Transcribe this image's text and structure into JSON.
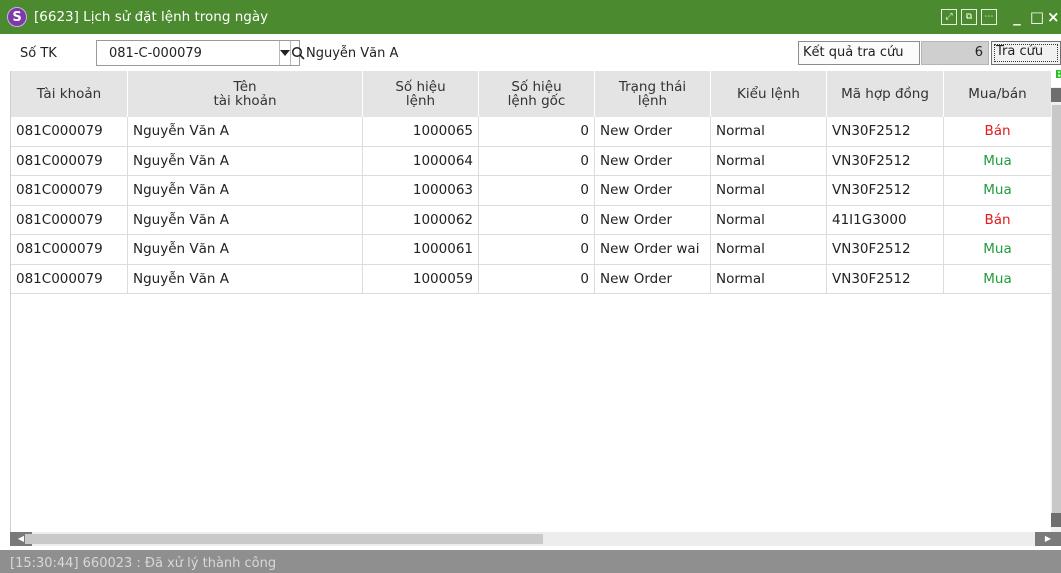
{
  "window": {
    "logo": "S",
    "title": "[6623] Lịch sử đặt lệnh trong ngày",
    "title_icons": [
      "expand-icon",
      "popout-icon",
      "more-icon"
    ],
    "controls": [
      "minimize-icon",
      "maximize-icon",
      "close-icon"
    ]
  },
  "toolbar": {
    "account_label": "Số TK",
    "account_value": "081-C-000079",
    "account_name": "Nguyễn Văn A",
    "result_label": "Kết quả tra cứu",
    "result_count": "6",
    "search_button": "Tra cứu"
  },
  "grid": {
    "columns": [
      {
        "key": "account",
        "label": "Tài khoản"
      },
      {
        "key": "name",
        "label": "Tên\ntài khoản"
      },
      {
        "key": "order_no",
        "label": "Số hiệu\nlệnh"
      },
      {
        "key": "orig_no",
        "label": "Số hiệu\nlệnh gốc"
      },
      {
        "key": "status",
        "label": "Trạng thái\nlệnh"
      },
      {
        "key": "type",
        "label": "Kiểu lệnh"
      },
      {
        "key": "contract",
        "label": "Mã hợp đồng"
      },
      {
        "key": "side",
        "label": "Mua/bán"
      }
    ],
    "rows": [
      {
        "account": "081C000079",
        "name": "Nguyễn Văn A",
        "order_no": "1000065",
        "orig_no": "0",
        "status": "New Order",
        "type": "Normal",
        "contract": "VN30F2512",
        "side": "Bán"
      },
      {
        "account": "081C000079",
        "name": "Nguyễn Văn A",
        "order_no": "1000064",
        "orig_no": "0",
        "status": "New Order",
        "type": "Normal",
        "contract": "VN30F2512",
        "side": "Mua"
      },
      {
        "account": "081C000079",
        "name": "Nguyễn Văn A",
        "order_no": "1000063",
        "orig_no": "0",
        "status": "New Order",
        "type": "Normal",
        "contract": "VN30F2512",
        "side": "Mua"
      },
      {
        "account": "081C000079",
        "name": "Nguyễn Văn A",
        "order_no": "1000062",
        "orig_no": "0",
        "status": "New Order",
        "type": "Normal",
        "contract": "41I1G3000",
        "side": "Bán"
      },
      {
        "account": "081C000079",
        "name": "Nguyễn Văn A",
        "order_no": "1000061",
        "orig_no": "0",
        "status": "New Order wai",
        "type": "Normal",
        "contract": "VN30F2512",
        "side": "Mua"
      },
      {
        "account": "081C000079",
        "name": "Nguyễn Văn A",
        "order_no": "1000059",
        "orig_no": "0",
        "status": "New Order",
        "type": "Normal",
        "contract": "VN30F2512",
        "side": "Mua"
      }
    ],
    "corner_mark": "B"
  },
  "status_bar": {
    "message": "[15:30:44] 660023 : Đã xử lý thành công"
  },
  "colors": {
    "title_bar": "#4b8a2e",
    "sell": "#e01b1b",
    "buy": "#1e9e3c",
    "header_bg": "#e4e4e4",
    "status_bar": "#8f8f8f"
  }
}
